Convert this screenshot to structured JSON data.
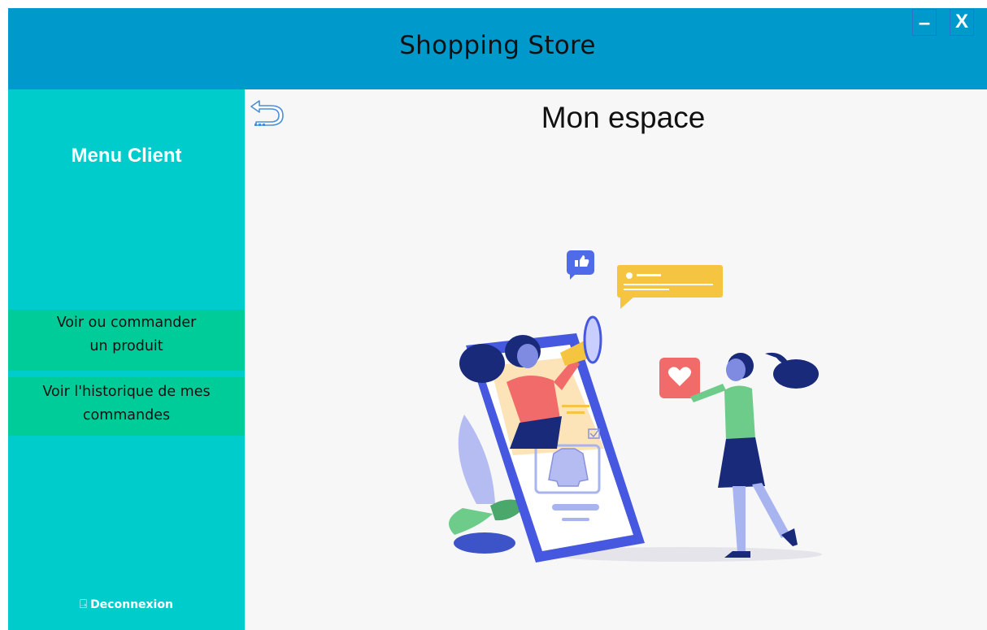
{
  "window": {
    "title": "Shopping Store",
    "minimize_label": "–",
    "close_label": "X"
  },
  "sidebar": {
    "title": "Menu Client",
    "items": [
      {
        "label_line1": "Voir ou commander",
        "label_line2": "un produit"
      },
      {
        "label_line1": "Voir l'historique de mes",
        "label_line2": "commandes"
      }
    ],
    "logout_icon": "logout-icon",
    "logout_label": "Deconnexion"
  },
  "main": {
    "back_icon": "back-arrow-icon",
    "title": "Mon espace",
    "illustration": "online-shopping-illustration"
  },
  "colors": {
    "header": "#0099cc",
    "sidebar": "#00cccc",
    "menu_item": "#00cc99",
    "content_bg": "#f7f7f7"
  }
}
